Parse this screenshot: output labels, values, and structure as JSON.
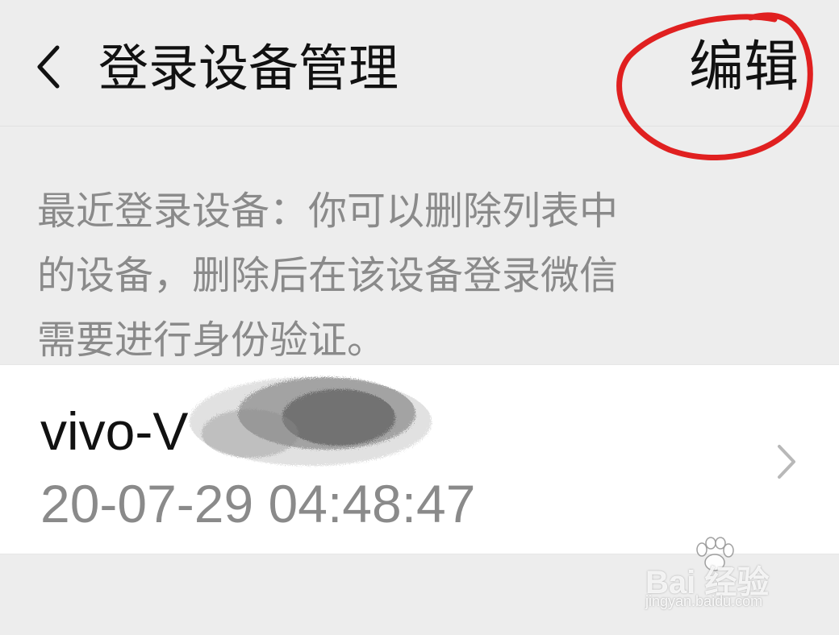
{
  "header": {
    "title": "登录设备管理",
    "edit_label": "编辑"
  },
  "description": {
    "lines": [
      "最近登录设备：你可以删除列表中",
      "的设备，删除后在该设备登录微信",
      "需要进行身份验证。"
    ]
  },
  "devices": [
    {
      "name": "vivo-V",
      "time": "20-07-29 04:48:47"
    }
  ],
  "watermark": {
    "logo": "Bai 经验",
    "url": "jingyan.baidu.com"
  },
  "colors": {
    "background": "#ededed",
    "card": "#ffffff",
    "secondary_text": "#8a8a8a",
    "annotation": "#e02020"
  }
}
